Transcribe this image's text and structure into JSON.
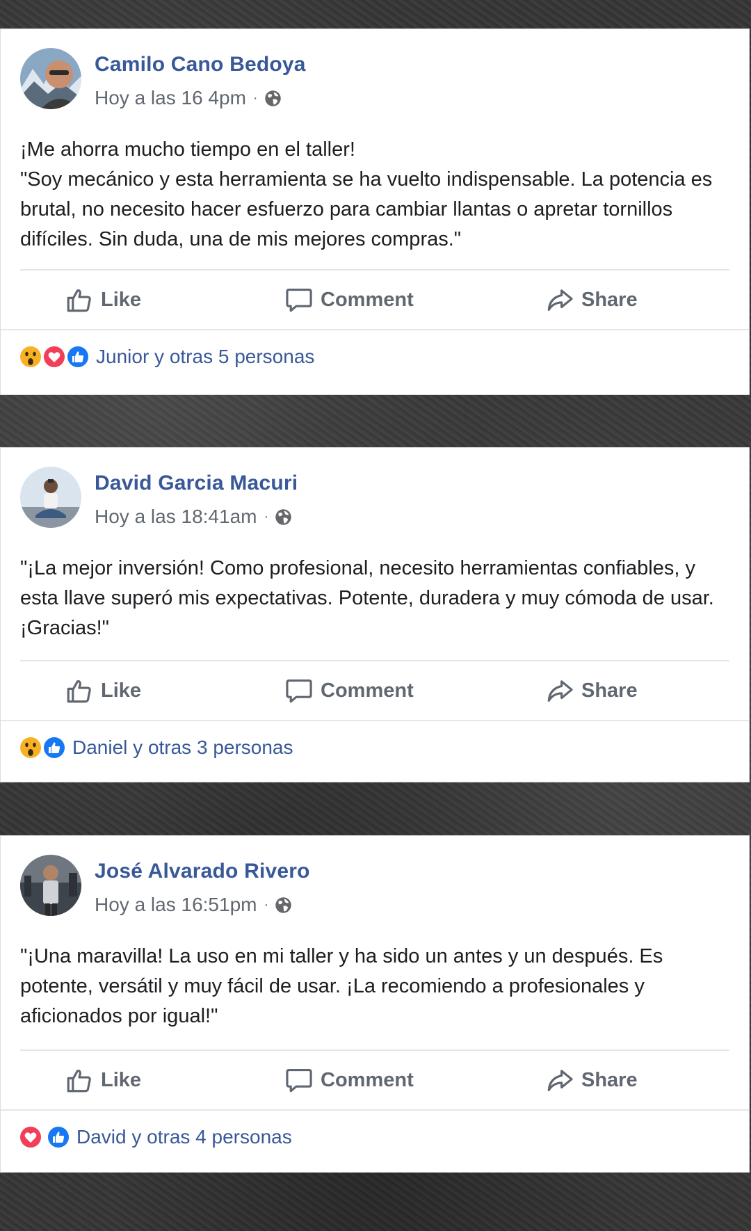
{
  "icons": {
    "globe": "globe-icon",
    "like": "thumbs-up-icon",
    "comment": "comment-bubble-icon",
    "share": "share-arrow-icon",
    "wow": "wow-reaction-icon",
    "love": "love-reaction-icon",
    "like_reaction": "like-reaction-icon"
  },
  "colors": {
    "author": "#385898",
    "meta": "#616770",
    "action": "#606770",
    "like_reaction": "#1877f2",
    "love_reaction": "#f33e58",
    "wow_reaction": "#f7b125"
  },
  "actions": {
    "like": "Like",
    "comment": "Comment",
    "share": "Share"
  },
  "posts": [
    {
      "author": "Camilo Cano Bedoya",
      "time": "Hoy a las 16   4pm",
      "meta_separator": "·",
      "body": [
        "¡Me ahorra mucho tiempo en el taller!",
        "\"Soy mecánico y esta herramienta se ha vuelto indispensable. La potencia es brutal, no necesito hacer esfuerzo para cambiar llantas o apretar tornillos difíciles. Sin duda, una de mis mejores compras.\""
      ],
      "reactions": [
        "wow",
        "love",
        "like"
      ],
      "reactions_text": "Junior y otras 5 personas"
    },
    {
      "author": "David Garcia Macuri",
      "time": "Hoy a las 18:41am",
      "meta_separator": "·",
      "body": [
        "\"¡La mejor inversión! Como profesional, necesito herramientas confiables, y esta llave superó mis expectativas. Potente, duradera y muy cómoda de usar. ¡Gracias!\""
      ],
      "reactions": [
        "wow",
        "like"
      ],
      "reactions_text": "Daniel y otras 3 personas"
    },
    {
      "author": "José Alvarado Rivero",
      "time": "Hoy a las 16:51pm",
      "meta_separator": "·",
      "body": [
        "\"¡Una maravilla! La uso en mi taller y ha sido un antes y un después. Es potente, versátil y muy fácil de usar. ¡La recomiendo a profesionales y aficionados por igual!\""
      ],
      "reactions": [
        "love",
        "like"
      ],
      "reactions_text": "David y otras 4 personas"
    }
  ]
}
